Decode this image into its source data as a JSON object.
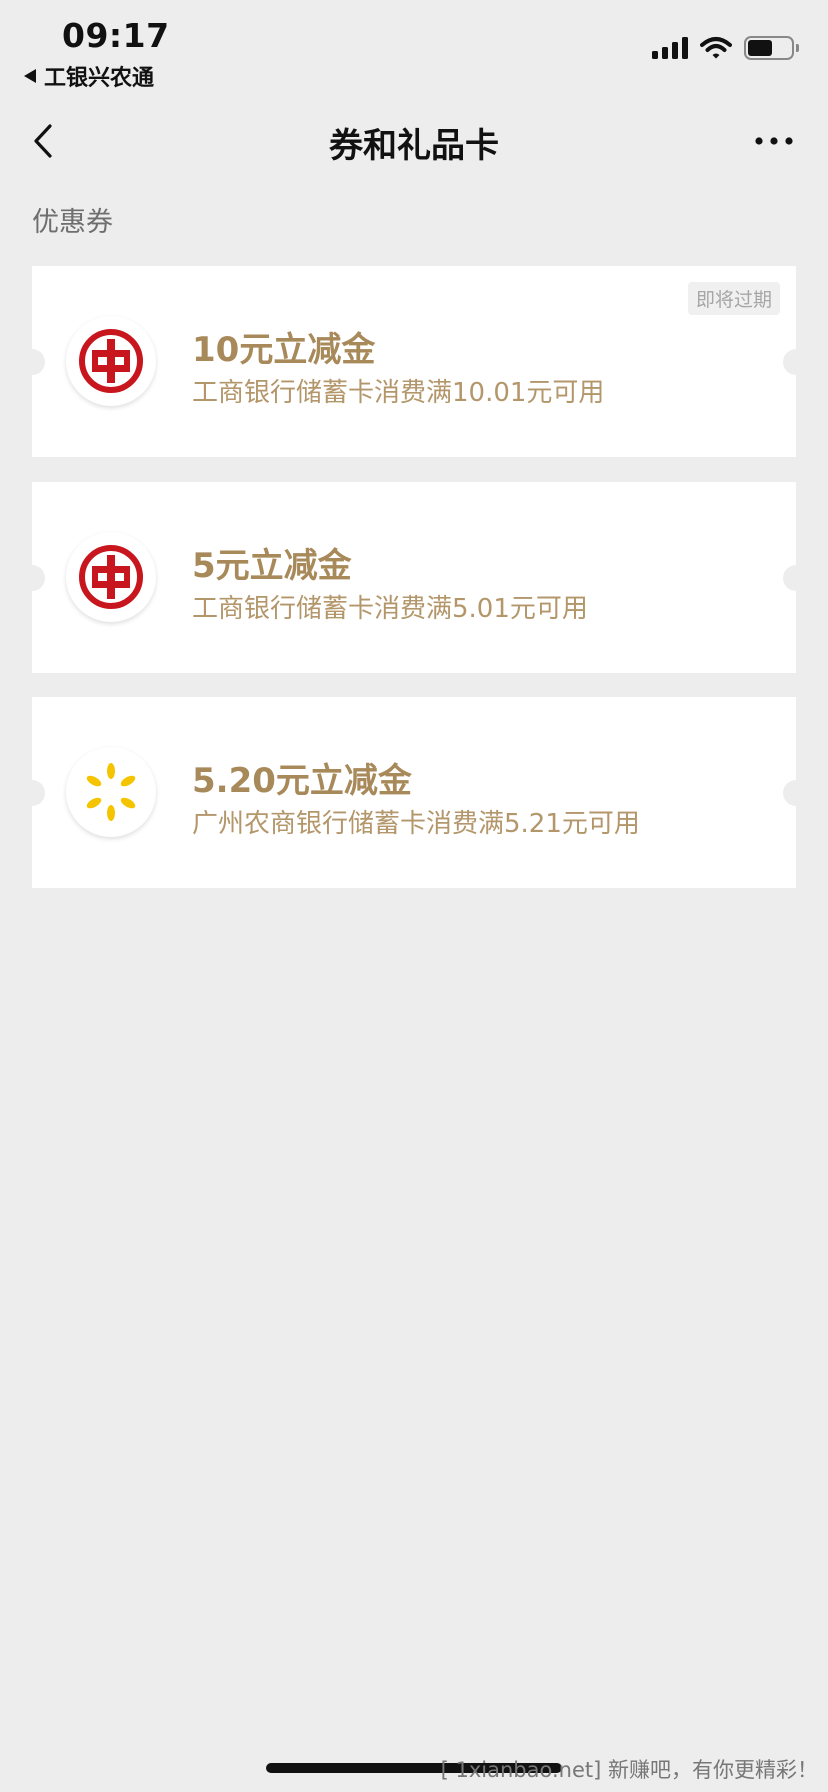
{
  "status_bar": {
    "time": "09:17",
    "back_app_label": "工银兴农通",
    "icons": [
      "cellular-signal-icon",
      "wifi-icon",
      "battery-icon"
    ],
    "battery_level": 0.56
  },
  "nav": {
    "title": "券和礼品卡",
    "back_icon": "chevron-left-icon",
    "more_icon": "more-dots-icon"
  },
  "section": {
    "title": "优惠券"
  },
  "coupons": [
    {
      "title": "10元立减金",
      "description": "工商银行储蓄卡消费满10.01元可用",
      "badge": "即将过期",
      "logo": "icbc-logo"
    },
    {
      "title": "5元立减金",
      "description": "工商银行储蓄卡消费满5.01元可用",
      "logo": "icbc-logo"
    },
    {
      "title": "5.20元立减金",
      "description": "广州农商银行储蓄卡消费满5.21元可用",
      "logo": "grcb-logo"
    }
  ],
  "watermark": "[ 1xianbao.net] 新赚吧，有你更精彩！",
  "colors": {
    "background": "#ededed",
    "coupon_title": "#a8895a",
    "coupon_desc": "#b3976b",
    "icbc_red": "#c7161e",
    "grcb_yellow": "#f5c400"
  }
}
